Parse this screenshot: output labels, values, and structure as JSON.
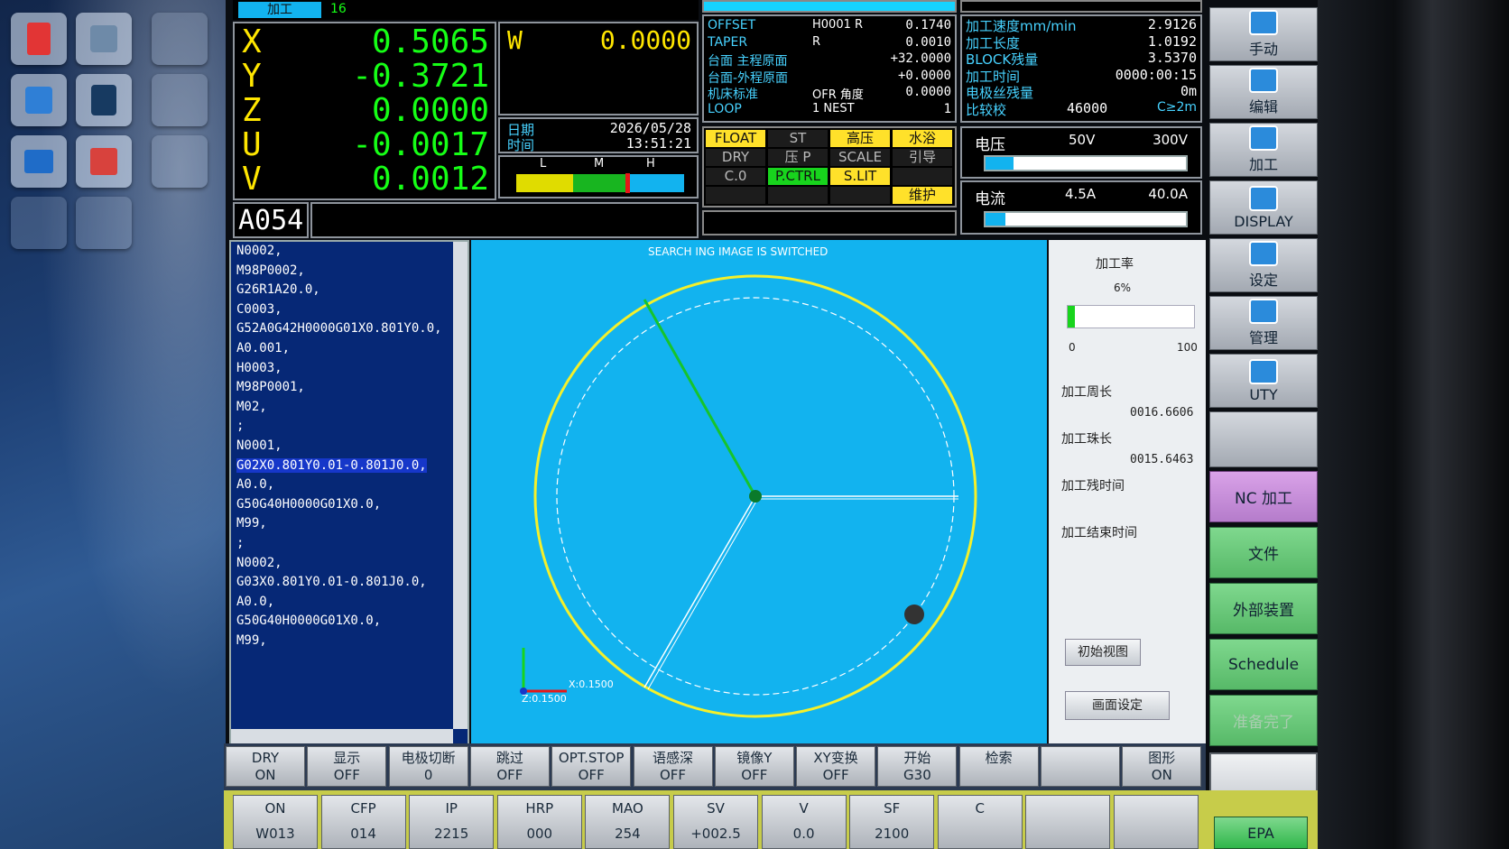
{
  "header": {
    "mode": "加工",
    "mode_num": "16"
  },
  "axes": [
    {
      "axis": "X",
      "value": "0.5065"
    },
    {
      "axis": "Y",
      "value": "-0.3721"
    },
    {
      "axis": "Z",
      "value": "0.0000"
    },
    {
      "axis": "U",
      "value": "-0.0017"
    },
    {
      "axis": "V",
      "value": "0.0012"
    }
  ],
  "w_axis": {
    "axis": "W",
    "value": "0.0000"
  },
  "datetime": {
    "label_date": "日期",
    "label_time": "时间",
    "date": "2026/05/28",
    "time": "13:51:21"
  },
  "lmh": {
    "l": "L",
    "m": "M",
    "h": "H",
    "level": 0.65
  },
  "offset": {
    "rows": [
      {
        "label": "OFFSET",
        "mid": "H0001 R",
        "val": "0.1740"
      },
      {
        "label": "TAPER",
        "mid": "R",
        "val": "0.0010"
      },
      {
        "label": "台面 主程原面",
        "mid": "",
        "val": "+32.0000"
      },
      {
        "label": "台面-外程原面",
        "mid": "",
        "val": "+0.0000"
      },
      {
        "label": "机床标准",
        "mid": "OFR 角度",
        "val": "0.0000"
      },
      {
        "label": "LOOP",
        "mid": "1 NEST",
        "val": "1"
      }
    ]
  },
  "machining": {
    "rows": [
      {
        "label": "加工速度mm/min",
        "val": "2.9126"
      },
      {
        "label": "加工长度",
        "val": "1.0192"
      },
      {
        "label": "BLOCK残量",
        "val": "3.5370"
      },
      {
        "label": "加工时间",
        "val": "0000:00:15"
      },
      {
        "label": "电极丝残量",
        "val": "0m"
      },
      {
        "label": "比较校",
        "val": "46000",
        "extra": "C≥2m"
      }
    ]
  },
  "lamps": [
    {
      "label": "FLOAT",
      "state": "y"
    },
    {
      "label": "ST",
      "state": "off"
    },
    {
      "label": "高压",
      "state": "y"
    },
    {
      "label": "水浴",
      "state": "y"
    },
    {
      "label": "DRY",
      "state": "off"
    },
    {
      "label": "压 P",
      "state": "off"
    },
    {
      "label": "SCALE",
      "state": "off"
    },
    {
      "label": "引导",
      "state": "off"
    },
    {
      "label": "C.0",
      "state": "off"
    },
    {
      "label": "P.CTRL",
      "state": "g"
    },
    {
      "label": "S.LIT",
      "state": "y"
    },
    {
      "label": "",
      "state": "off"
    },
    {
      "label": "",
      "state": "off"
    },
    {
      "label": "",
      "state": "off"
    },
    {
      "label": "",
      "state": "off"
    },
    {
      "label": "维护",
      "state": "y"
    }
  ],
  "voltage": {
    "label": "电压",
    "mid": "50V",
    "max": "300V",
    "level": 0.14
  },
  "current": {
    "label": "电流",
    "mid": "4.5A",
    "max": "40.0A",
    "level": 0.1
  },
  "program_id": "A054",
  "code_lines": [
    "N0002,",
    "M98P0002,",
    "G26R1A20.0,",
    "C0003,",
    "G52A0G42H0000G01X0.801Y0.0,",
    "A0.001,",
    "H0003,",
    "M98P0001,",
    "M02,",
    ";",
    "N0001,",
    "G02X0.801Y0.01-0.801J0.0,",
    "A0.0,",
    "G50G40H0000G01X0.0,",
    "M99,",
    ";",
    "N0002,",
    "G03X0.801Y0.01-0.801J0.0,",
    "A0.0,",
    "G50G40H0000G01X0.0,",
    "M99,"
  ],
  "highlight_line": 11,
  "graphic": {
    "status": "SEARCH ING    IMAGE IS SWITCHED",
    "x_scale": "X:0.1500",
    "z_scale": "Z:0.1500"
  },
  "right_info": {
    "rate_label": "加工率",
    "rate": "6%",
    "rate_value": 0.06,
    "min": "0",
    "max": "100",
    "perimeter_label": "加工周长",
    "perimeter": "0016.6606",
    "bead_label": "加工珠长",
    "bead": "0015.6463",
    "remain_label": "加工残时间",
    "end_label": "加工结束时间",
    "btn_init": "初始视图",
    "btn_settings": "画面设定"
  },
  "side_menu": [
    {
      "label": "手动",
      "icon": "hand-icon"
    },
    {
      "label": "编辑",
      "icon": "edit-icon"
    },
    {
      "label": "加工",
      "icon": "machine-icon"
    },
    {
      "label": "DISPLAY",
      "icon": "display-icon"
    },
    {
      "label": "设定",
      "icon": "gear-icon"
    },
    {
      "label": "管理",
      "icon": "manage-icon"
    },
    {
      "label": "UTY",
      "icon": "utility-icon"
    }
  ],
  "green_menu": [
    "NC 加工",
    "文件",
    "外部装置",
    "Schedule",
    "准备完了"
  ],
  "func_buttons": [
    {
      "top": "DRY",
      "bottom": "ON"
    },
    {
      "top": "显示",
      "bottom": "OFF"
    },
    {
      "top": "电极切断",
      "bottom": "0"
    },
    {
      "top": "跳过",
      "bottom": "OFF"
    },
    {
      "top": "OPT.STOP",
      "bottom": "OFF"
    },
    {
      "top": "语感深",
      "bottom": "OFF"
    },
    {
      "top": "镜像Y",
      "bottom": "OFF"
    },
    {
      "top": "XY变换",
      "bottom": "OFF"
    },
    {
      "top": "开始",
      "bottom": "G30"
    },
    {
      "top": "检索",
      "bottom": ""
    },
    {
      "top": "",
      "bottom": ""
    },
    {
      "top": "图形",
      "bottom": "ON"
    }
  ],
  "status_cells": [
    {
      "top": "ON",
      "bottom": "W013"
    },
    {
      "top": "CFP",
      "bottom": "014"
    },
    {
      "top": "IP",
      "bottom": "2215"
    },
    {
      "top": "HRP",
      "bottom": "000"
    },
    {
      "top": "MAO",
      "bottom": "254"
    },
    {
      "top": "SV",
      "bottom": "+002.5"
    },
    {
      "top": "V",
      "bottom": "0.0"
    },
    {
      "top": "SF",
      "bottom": "2100"
    },
    {
      "top": "C",
      "bottom": ""
    },
    {
      "top": "",
      "bottom": ""
    },
    {
      "top": "",
      "bottom": ""
    }
  ],
  "epa": "EPA",
  "colors": {
    "graphic_bg": "#12b3ef",
    "code_bg": "#062876",
    "accent_yellow": "#ffe600",
    "accent_green": "#16ff16",
    "label_cyan": "#47d2ff"
  }
}
